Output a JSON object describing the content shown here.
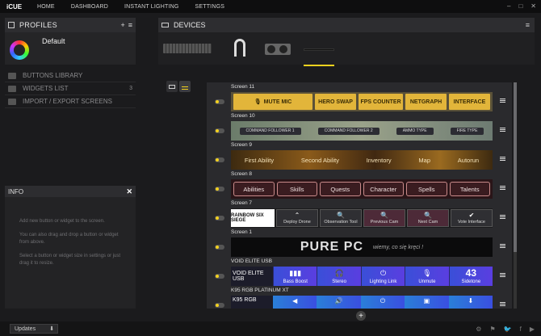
{
  "app": {
    "logo": "iCUE"
  },
  "nav": [
    {
      "label": "HOME"
    },
    {
      "label": "DASHBOARD"
    },
    {
      "label": "INSTANT LIGHTING"
    },
    {
      "label": "SETTINGS"
    }
  ],
  "window": {
    "minimize": "–",
    "maximize": "□",
    "close": "✕"
  },
  "profiles": {
    "title": "PROFILES",
    "add": "+",
    "menu": "≡",
    "items": [
      {
        "name": "Default"
      }
    ]
  },
  "library": [
    {
      "label": "BUTTONS LIBRARY",
      "count": ""
    },
    {
      "label": "WIDGETS LIST",
      "count": "3"
    },
    {
      "label": "IMPORT / EXPORT SCREENS",
      "count": ""
    }
  ],
  "info": {
    "title": "INFO",
    "close": "✕",
    "lines": [
      "Add new button or widget to the screen.",
      "You can also drag and drop a button or widget from above.",
      "Select a button or widget size in settings or just drag it to resize."
    ]
  },
  "devices": {
    "title": "DEVICES",
    "menu": "≡"
  },
  "screens": [
    {
      "label": "Screen 11",
      "buttons": [
        "MUTE MIC",
        "HERO SWAP",
        "FPS COUNTER",
        "NETGRAPH",
        "INTERFACE"
      ],
      "mic_glyph": "🎙"
    },
    {
      "label": "Screen 10",
      "buttons": [
        "COMMAND FOLLOWER 1",
        "COMMAND FOLLOWER 2",
        "AMMO TYPE",
        "FIRE TYPE"
      ]
    },
    {
      "label": "Screen 9",
      "buttons": [
        "First Ability",
        "Second Ability",
        "Inventory",
        "Map",
        "Autorun"
      ]
    },
    {
      "label": "Screen 8",
      "buttons": [
        "Abilities",
        "Skills",
        "Quests",
        "Character",
        "Spells",
        "Talents"
      ]
    },
    {
      "label": "Screen 7",
      "logo": "RAINBOW SIX SIEGE",
      "buttons": [
        {
          "label": "Deploy Drone",
          "glyph": "⌃"
        },
        {
          "label": "Observation Tool",
          "glyph": "🔍"
        },
        {
          "label": "Previous Cam",
          "glyph": "🔍"
        },
        {
          "label": "Next Cam",
          "glyph": "🔍"
        },
        {
          "label": "Vote Interface",
          "glyph": "✔"
        }
      ]
    },
    {
      "label": "Screen 1",
      "brand": "PURE PC",
      "tagline": "wiemy, co się kręci !"
    },
    {
      "label": "VOID ELITE USB",
      "name": "VOID ELITE USB",
      "buttons": [
        {
          "label": "Bass Boost",
          "glyph": "▮▮▮"
        },
        {
          "label": "Stereo",
          "glyph": "🎧"
        },
        {
          "label": "Lighting Link",
          "glyph": "⏻"
        },
        {
          "label": "Unmute",
          "glyph": "🎙"
        },
        {
          "label": "Sidetone",
          "big": "43"
        }
      ]
    },
    {
      "label": "K95 RGB PLATINUM XT",
      "name": "K95 RGB",
      "glyphs": [
        "◀",
        "🔊",
        "⏻",
        "▣",
        "⬇"
      ]
    }
  ],
  "add_button": "+",
  "updates": {
    "label": "Updates",
    "icon": "⬇"
  },
  "social": [
    "⚙",
    "⚑",
    "🐦",
    "f",
    "▶"
  ]
}
